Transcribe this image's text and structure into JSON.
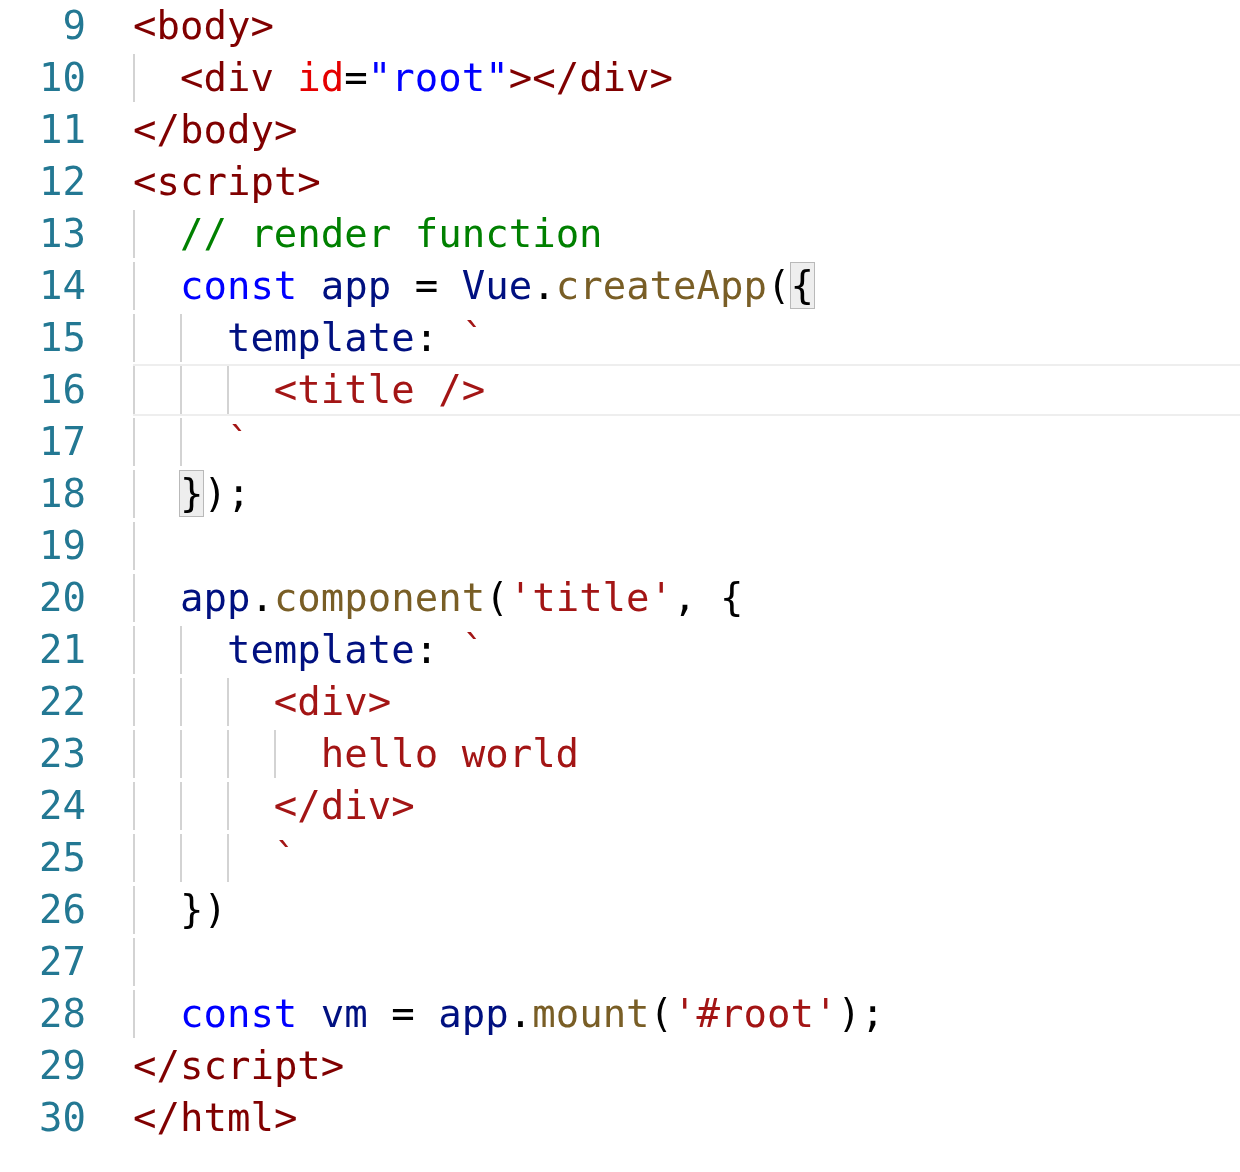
{
  "editor": {
    "lines": [
      {
        "number": "9",
        "current": false,
        "tokens": [
          {
            "kind": "tag",
            "text": "<body>"
          }
        ]
      },
      {
        "number": "10",
        "guides": [
          {
            "kind": "guide"
          }
        ],
        "current": false,
        "tokens": [
          {
            "kind": "tag",
            "text": "<div "
          },
          {
            "kind": "attr",
            "text": "id"
          },
          {
            "kind": "plain",
            "text": "="
          },
          {
            "kind": "attrvalue",
            "text": "\"root\""
          },
          {
            "kind": "tag",
            "text": "></div>"
          }
        ]
      },
      {
        "number": "11",
        "current": false,
        "tokens": [
          {
            "kind": "tag",
            "text": "</body>"
          }
        ]
      },
      {
        "number": "12",
        "current": false,
        "tokens": [
          {
            "kind": "tag",
            "text": "<script>"
          }
        ]
      },
      {
        "number": "13",
        "guides": [
          {
            "kind": "guide"
          }
        ],
        "current": false,
        "tokens": [
          {
            "kind": "comment",
            "text": "// render function"
          }
        ]
      },
      {
        "number": "14",
        "guides": [
          {
            "kind": "guide"
          }
        ],
        "current": false,
        "tokens": [
          {
            "kind": "keyword",
            "text": "const "
          },
          {
            "kind": "variable",
            "text": "app"
          },
          {
            "kind": "plain",
            "text": " = "
          },
          {
            "kind": "variable",
            "text": "Vue"
          },
          {
            "kind": "plain",
            "text": "."
          },
          {
            "kind": "function",
            "text": "createApp"
          },
          {
            "kind": "plain",
            "text": "("
          },
          {
            "kind": "bracket",
            "text": "{"
          }
        ]
      },
      {
        "number": "15",
        "guides": [
          {
            "kind": "guide"
          },
          {
            "kind": "guide"
          }
        ],
        "current": false,
        "tokens": [
          {
            "kind": "variable",
            "text": "template"
          },
          {
            "kind": "plain",
            "text": ": "
          },
          {
            "kind": "string",
            "text": "`"
          }
        ]
      },
      {
        "number": "16",
        "guides": [
          {
            "kind": "guide"
          },
          {
            "kind": "guide"
          },
          {
            "kind": "guide"
          }
        ],
        "current": true,
        "tokens": [
          {
            "kind": "string",
            "text": "<title />"
          }
        ]
      },
      {
        "number": "17",
        "guides": [
          {
            "kind": "guide"
          },
          {
            "kind": "guide"
          }
        ],
        "current": false,
        "tokens": [
          {
            "kind": "string",
            "text": "`"
          }
        ]
      },
      {
        "number": "18",
        "guides": [
          {
            "kind": "guide"
          }
        ],
        "current": false,
        "tokens": [
          {
            "kind": "bracket",
            "text": "}"
          },
          {
            "kind": "plain",
            "text": ");"
          }
        ]
      },
      {
        "number": "19",
        "guides": [
          {
            "kind": "guide"
          }
        ],
        "current": false
      },
      {
        "number": "20",
        "guides": [
          {
            "kind": "guide"
          }
        ],
        "current": false,
        "tokens": [
          {
            "kind": "variable",
            "text": "app"
          },
          {
            "kind": "plain",
            "text": "."
          },
          {
            "kind": "function",
            "text": "component"
          },
          {
            "kind": "plain",
            "text": "("
          },
          {
            "kind": "string",
            "text": "'title'"
          },
          {
            "kind": "plain",
            "text": ", {"
          }
        ]
      },
      {
        "number": "21",
        "guides": [
          {
            "kind": "guide"
          },
          {
            "kind": "guide"
          }
        ],
        "current": false,
        "tokens": [
          {
            "kind": "variable",
            "text": "template"
          },
          {
            "kind": "plain",
            "text": ": "
          },
          {
            "kind": "string",
            "text": "`"
          }
        ]
      },
      {
        "number": "22",
        "guides": [
          {
            "kind": "guide"
          },
          {
            "kind": "guide"
          },
          {
            "kind": "guide"
          }
        ],
        "current": false,
        "tokens": [
          {
            "kind": "string",
            "text": "<div>"
          }
        ]
      },
      {
        "number": "23",
        "guides": [
          {
            "kind": "guide"
          },
          {
            "kind": "guide"
          },
          {
            "kind": "guide"
          },
          {
            "kind": "guide"
          }
        ],
        "current": false,
        "tokens": [
          {
            "kind": "string",
            "text": "hello world"
          }
        ]
      },
      {
        "number": "24",
        "guides": [
          {
            "kind": "guide"
          },
          {
            "kind": "guide"
          },
          {
            "kind": "guide"
          }
        ],
        "current": false,
        "tokens": [
          {
            "kind": "string",
            "text": "</div>"
          }
        ]
      },
      {
        "number": "25",
        "guides": [
          {
            "kind": "guide"
          },
          {
            "kind": "guide"
          },
          {
            "kind": "guide"
          }
        ],
        "current": false,
        "tokens": [
          {
            "kind": "string",
            "text": "`"
          }
        ]
      },
      {
        "number": "26",
        "guides": [
          {
            "kind": "guide"
          }
        ],
        "current": false,
        "tokens": [
          {
            "kind": "plain",
            "text": "})"
          }
        ]
      },
      {
        "number": "27",
        "guides": [
          {
            "kind": "guide"
          }
        ],
        "current": false
      },
      {
        "number": "28",
        "guides": [
          {
            "kind": "guide"
          }
        ],
        "current": false,
        "tokens": [
          {
            "kind": "keyword",
            "text": "const "
          },
          {
            "kind": "variable",
            "text": "vm"
          },
          {
            "kind": "plain",
            "text": " = "
          },
          {
            "kind": "variable",
            "text": "app"
          },
          {
            "kind": "plain",
            "text": "."
          },
          {
            "kind": "function",
            "text": "mount"
          },
          {
            "kind": "plain",
            "text": "("
          },
          {
            "kind": "string",
            "text": "'#root'"
          },
          {
            "kind": "plain",
            "text": ");"
          }
        ]
      },
      {
        "number": "29",
        "current": false,
        "tokens": [
          {
            "kind": "tag",
            "text": "</script>"
          }
        ]
      },
      {
        "number": "30",
        "current": false,
        "tokens": [
          {
            "kind": "tag",
            "text": "</html>"
          }
        ]
      }
    ]
  }
}
